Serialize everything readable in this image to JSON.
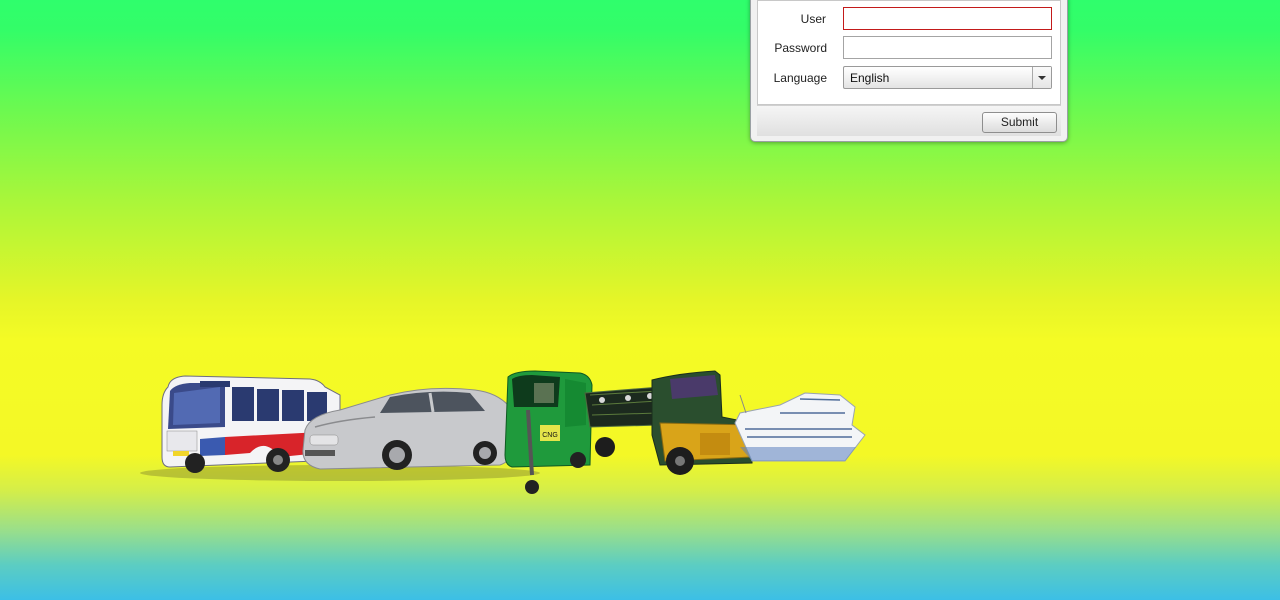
{
  "login": {
    "user_label": "User",
    "user_value": "",
    "password_label": "Password",
    "password_value": "",
    "language_label": "Language",
    "language_selected": "English",
    "submit_label": "Submit"
  },
  "illustration": {
    "vehicles": [
      "bus",
      "car",
      "cng-auto-rickshaw",
      "truck",
      "cruise-ship"
    ],
    "bus_route_sign": "",
    "cng_text": "CNG"
  },
  "colors": {
    "bg_top": "#2ffe6c",
    "bg_middle": "#f4fb25",
    "bg_bottom": "#3cbfe6",
    "invalid_border": "#c31a1a"
  }
}
